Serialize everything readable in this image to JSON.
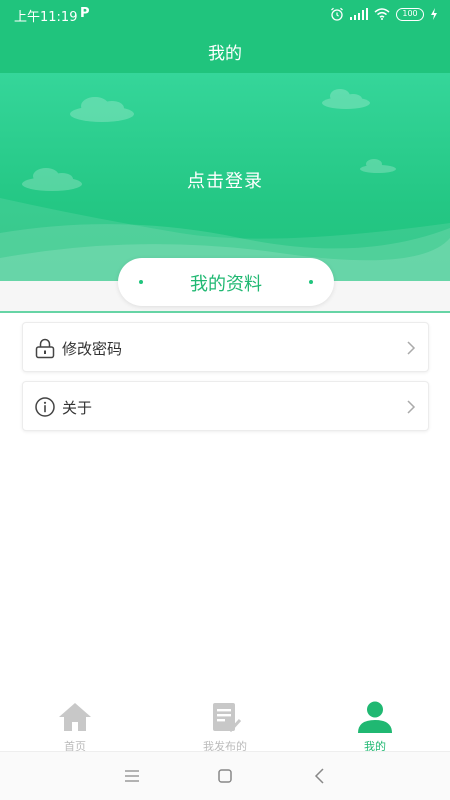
{
  "status_bar": {
    "time": "上午11:19",
    "app_indicator": "P",
    "battery": "100",
    "icons": [
      "alarm-icon",
      "signal-icon",
      "wifi-icon",
      "battery-icon",
      "charging-icon"
    ]
  },
  "header": {
    "title": "我的"
  },
  "hero": {
    "login_text": "点击登录"
  },
  "profile_section": {
    "title": "我的资料"
  },
  "menu": {
    "items": [
      {
        "label": "修改密码",
        "icon": "lock-icon"
      },
      {
        "label": "关于",
        "icon": "info-icon"
      }
    ]
  },
  "tab_bar": {
    "tabs": [
      {
        "label": "首页",
        "icon": "home-icon",
        "active": false
      },
      {
        "label": "我发布的",
        "icon": "document-check-icon",
        "active": false
      },
      {
        "label": "我的",
        "icon": "user-icon",
        "active": true
      }
    ]
  },
  "colors": {
    "primary": "#20c47d",
    "accent_text": "#20b872",
    "inactive_tab": "#bbbbbb"
  }
}
